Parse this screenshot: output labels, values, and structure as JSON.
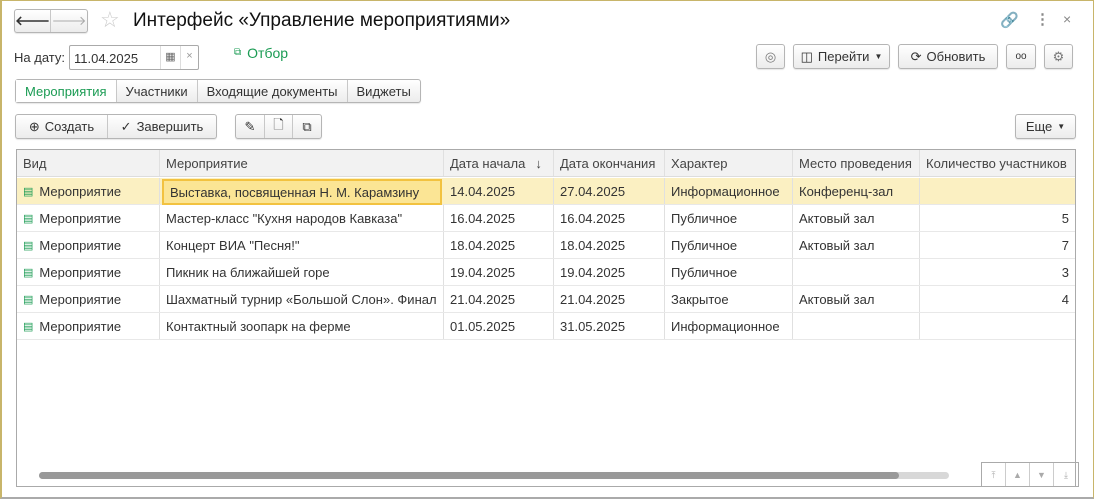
{
  "header": {
    "title": "Интерфейс «Управление мероприятиями»"
  },
  "filter": {
    "date_label": "На дату:",
    "date_value": "11.04.2025",
    "selection_link": "Отбор"
  },
  "toolbar_right": {
    "goto": "Перейти",
    "refresh": "Обновить"
  },
  "tabs": [
    {
      "label": "Мероприятия",
      "active": true
    },
    {
      "label": "Участники"
    },
    {
      "label": "Входящие документы"
    },
    {
      "label": "Виджеты"
    }
  ],
  "commands": {
    "create": "Создать",
    "finish": "Завершить",
    "more": "Еще"
  },
  "table": {
    "columns": [
      "Вид",
      "Мероприятие",
      "Дата начала",
      "Дата окончания",
      "Характер",
      "Место проведения",
      "Количество участников"
    ],
    "sort_indicator": "↓",
    "rows": [
      [
        "Мероприятие",
        "Выставка, посвященная Н. М. Карамзину",
        "14.04.2025",
        "27.04.2025",
        "Информационное",
        "Конференц-зал",
        ""
      ],
      [
        "Мероприятие",
        "Мастер-класс \"Кухня народов Кавказа\"",
        "16.04.2025",
        "16.04.2025",
        "Публичное",
        "Актовый зал",
        "5"
      ],
      [
        "Мероприятие",
        "Концерт ВИА \"Песня!\"",
        "18.04.2025",
        "18.04.2025",
        "Публичное",
        "Актовый зал",
        "7"
      ],
      [
        "Мероприятие",
        "Пикник на ближайшей горе",
        "19.04.2025",
        "19.04.2025",
        "Публичное",
        "",
        "3"
      ],
      [
        "Мероприятие",
        "Шахматный турнир «Большой Слон». Финал",
        "21.04.2025",
        "21.04.2025",
        "Закрытое",
        "Актовый зал",
        "4"
      ],
      [
        "Мероприятие",
        "Контактный зоопарк на ферме",
        "01.05.2025",
        "31.05.2025",
        "Информационное",
        "",
        ""
      ]
    ]
  },
  "colors": {
    "accent": "#1a9b53",
    "selected_row": "#fbf0c2",
    "focus_cell": "#f2c240"
  }
}
